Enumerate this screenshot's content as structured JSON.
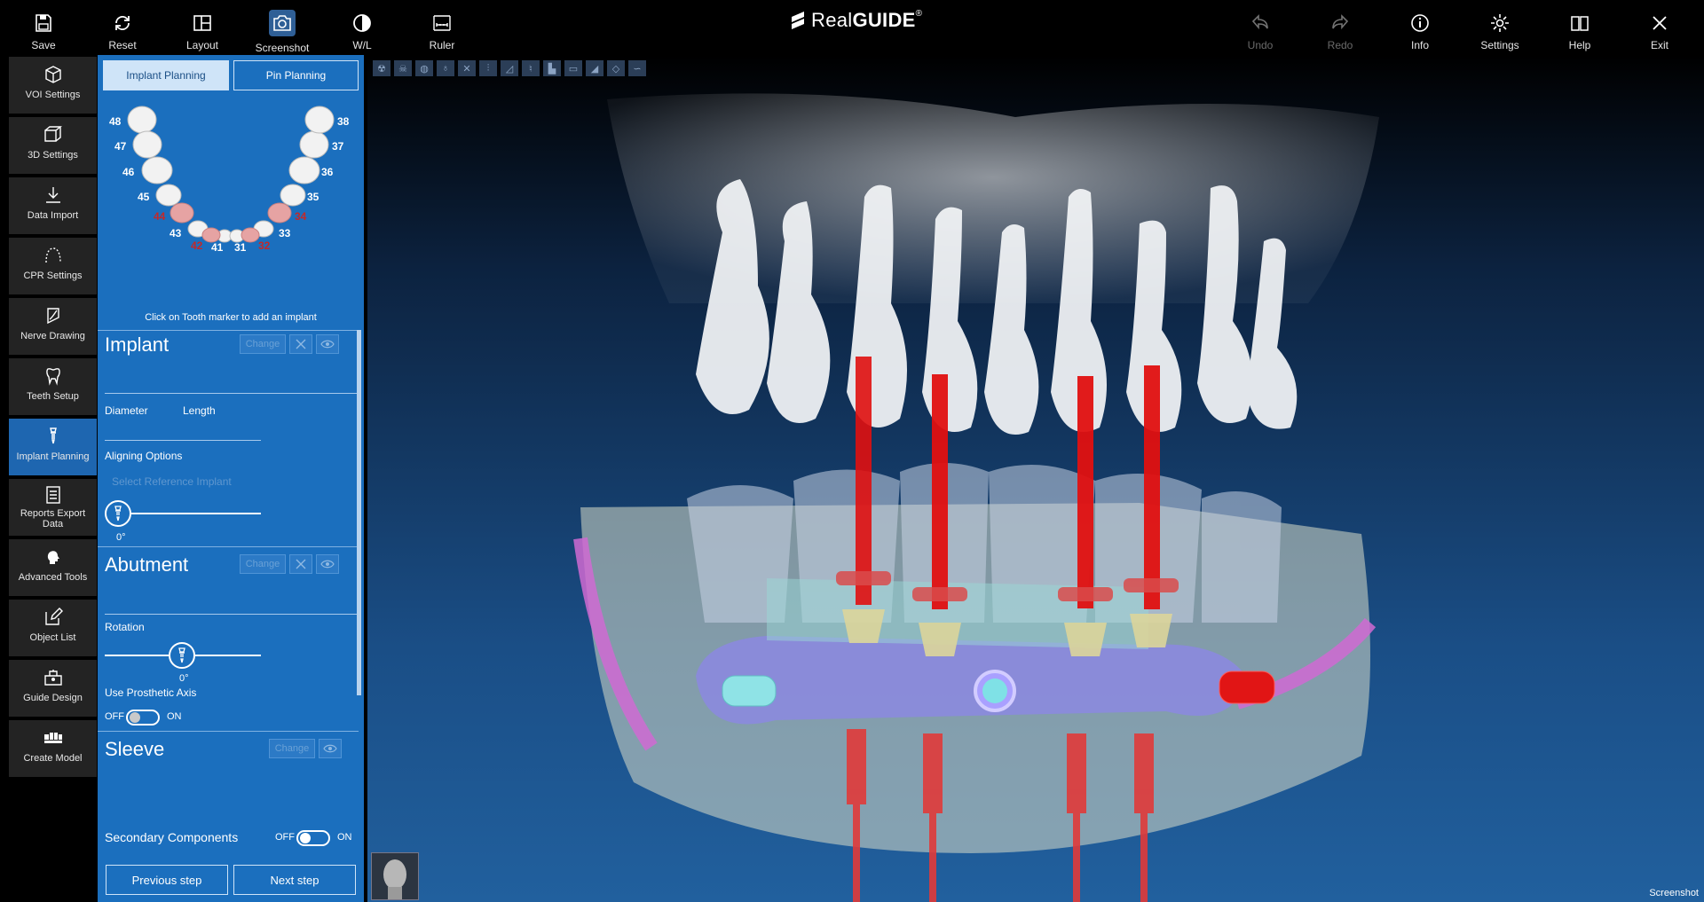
{
  "toolbar": {
    "left": [
      {
        "id": "save",
        "label": "Save",
        "icon": "save-icon"
      },
      {
        "id": "reset",
        "label": "Reset",
        "icon": "reset-icon"
      },
      {
        "id": "layout",
        "label": "Layout",
        "icon": "layout-icon"
      },
      {
        "id": "screenshot",
        "label": "Screenshot",
        "icon": "camera-icon"
      },
      {
        "id": "wl",
        "label": "W/L",
        "icon": "contrast-icon"
      },
      {
        "id": "ruler",
        "label": "Ruler",
        "icon": "ruler-icon"
      }
    ],
    "right": [
      {
        "id": "undo",
        "label": "Undo",
        "icon": "undo-icon",
        "disabled": true
      },
      {
        "id": "redo",
        "label": "Redo",
        "icon": "redo-icon",
        "disabled": true
      },
      {
        "id": "info",
        "label": "Info",
        "icon": "info-icon"
      },
      {
        "id": "settings",
        "label": "Settings",
        "icon": "gear-icon"
      },
      {
        "id": "help",
        "label": "Help",
        "icon": "book-icon"
      },
      {
        "id": "exit",
        "label": "Exit",
        "icon": "close-icon"
      }
    ],
    "logo": {
      "light": "Real",
      "bold": "GUIDE",
      "reg": "®"
    }
  },
  "sidebar": {
    "items": [
      {
        "label": "VOI Settings",
        "icon": "cube-icon"
      },
      {
        "label": "3D Settings",
        "icon": "cube-3d-icon"
      },
      {
        "label": "Data Import",
        "icon": "download-icon"
      },
      {
        "label": "CPR Settings",
        "icon": "arch-icon"
      },
      {
        "label": "Nerve Drawing",
        "icon": "nerve-icon"
      },
      {
        "label": "Teeth Setup",
        "icon": "tooth-icon"
      },
      {
        "label": "Implant Planning",
        "icon": "implant-icon",
        "active": true
      },
      {
        "label": "Reports Export Data",
        "icon": "report-icon"
      },
      {
        "label": "Advanced Tools",
        "icon": "head-icon"
      },
      {
        "label": "Object List",
        "icon": "edit-icon"
      },
      {
        "label": "Guide Design",
        "icon": "guide-icon"
      },
      {
        "label": "Create Model",
        "icon": "model-icon"
      }
    ]
  },
  "panel": {
    "tabs": {
      "implant": "Implant Planning",
      "pin": "Pin Planning"
    },
    "teeth_numbers": {
      "t48": "48",
      "t47": "47",
      "t46": "46",
      "t45": "45",
      "t44": "44",
      "t43": "43",
      "t42": "42",
      "t41": "41",
      "t31": "31",
      "t32": "32",
      "t33": "33",
      "t34": "34",
      "t35": "35",
      "t36": "36",
      "t37": "37",
      "t38": "38"
    },
    "hint": "Click on Tooth marker to add an implant",
    "implant": {
      "title": "Implant",
      "change": "Change",
      "diameter": "Diameter",
      "length": "Length",
      "aligning": "Aligning Options",
      "select_ref": "Select Reference Implant",
      "angle": "0°"
    },
    "abutment": {
      "title": "Abutment",
      "change": "Change",
      "rotation": "Rotation",
      "angle": "0°",
      "prosthetic": "Use Prosthetic Axis",
      "off": "OFF",
      "on": "ON"
    },
    "sleeve": {
      "title": "Sleeve",
      "change": "Change"
    },
    "secondary": {
      "label": "Secondary Components",
      "off": "OFF",
      "on": "ON"
    },
    "buttons": {
      "prev": "Previous step",
      "next": "Next step"
    }
  },
  "viewport": {
    "label": "Screenshot"
  },
  "colors": {
    "panel": "#1b6fbe",
    "active_nav": "#1e66b0",
    "implant_red": "#e01010"
  }
}
